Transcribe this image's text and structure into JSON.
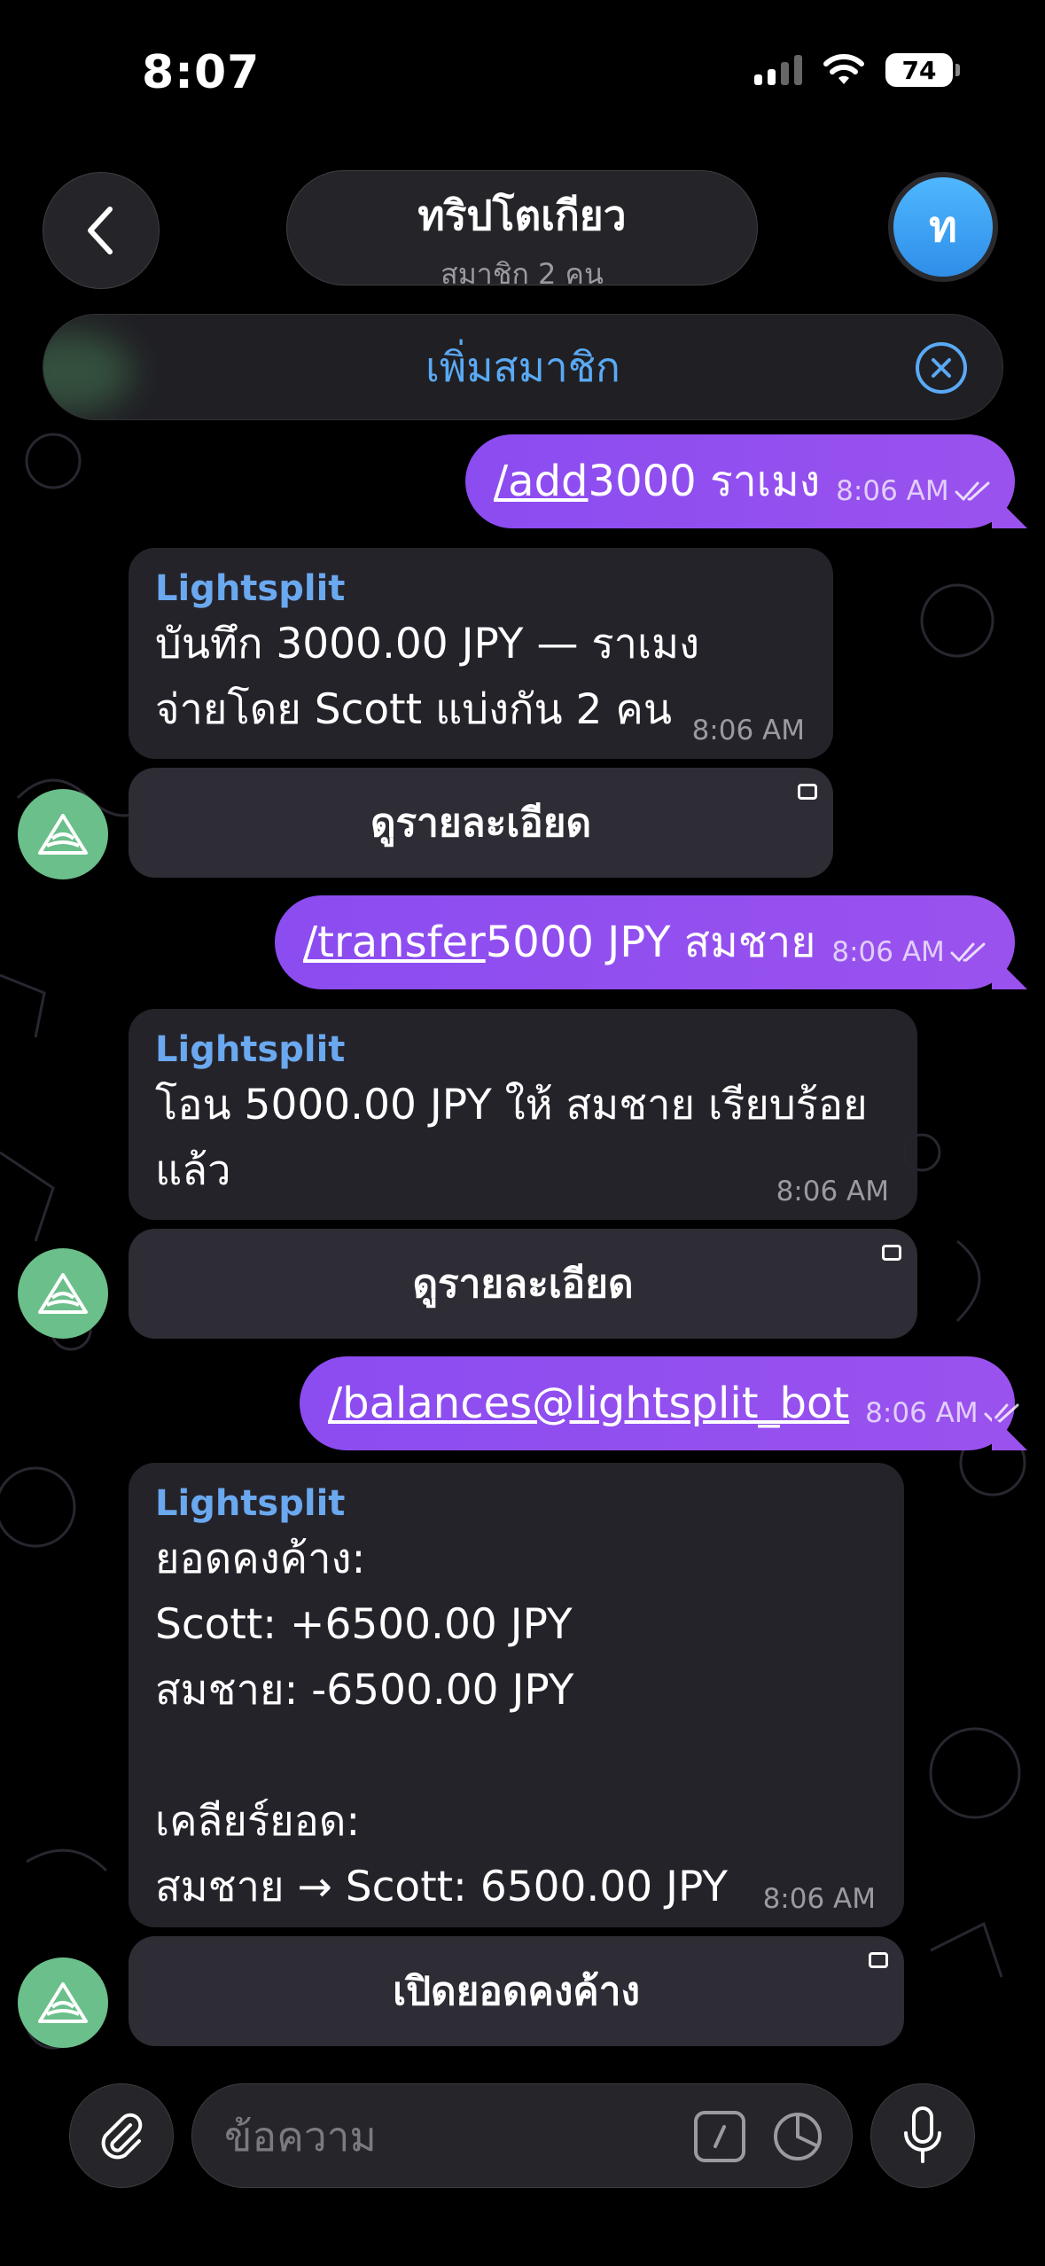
{
  "status_bar": {
    "time": "8:07",
    "battery": "74"
  },
  "header": {
    "title": "ทริปโตเกียว",
    "subtitle": "สมาชิก 2 คน",
    "avatar_letter": "ท"
  },
  "banner": {
    "label": "เพิ่มสมาชิก"
  },
  "messages": [
    {
      "type": "outgoing",
      "command": "/add",
      "text": " 3000 ราเมง",
      "time": "8:06 AM"
    },
    {
      "type": "incoming",
      "sender": "Lightsplit",
      "body": "บันทึก 3000.00 JPY — ราเมง\nจ่ายโดย Scott แบ่งกัน 2 คน",
      "time": "8:06 AM",
      "button": "ดูรายละเอียด"
    },
    {
      "type": "outgoing",
      "command": "/transfer",
      "text": " 5000 JPY สมชาย",
      "time": "8:06 AM"
    },
    {
      "type": "incoming",
      "sender": "Lightsplit",
      "body": "โอน 5000.00 JPY ให้ สมชาย เรียบร้อย\nแล้ว",
      "time": "8:06 AM",
      "button": "ดูรายละเอียด"
    },
    {
      "type": "outgoing",
      "command": "/balances@lightsplit_bot",
      "text": "",
      "time": "8:06 AM"
    },
    {
      "type": "incoming",
      "sender": "Lightsplit",
      "body": "ยอดคงค้าง:\nScott: +6500.00 JPY\nสมชาย: -6500.00 JPY\n\nเคลียร์ยอด:\nสมชาย → Scott: 6500.00 JPY",
      "time": "8:06 AM",
      "button": "เปิดยอดคงค้าง"
    }
  ],
  "composer": {
    "placeholder": "ข้อความ"
  },
  "colors": {
    "outgoing": "#8b4cf0",
    "accent": "#5aa9f5",
    "bot_avatar": "#6bbf8a"
  }
}
